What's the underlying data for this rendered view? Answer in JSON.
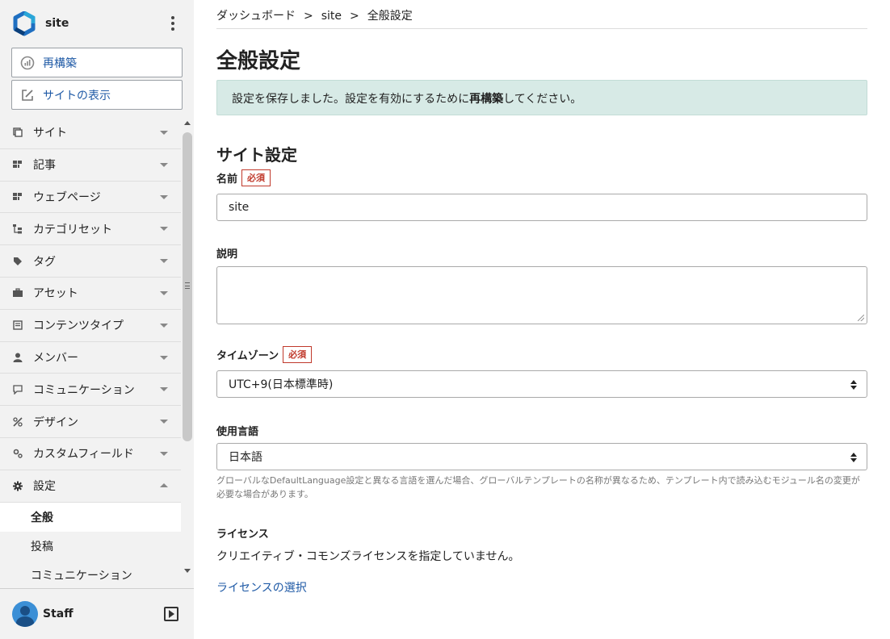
{
  "sidebar": {
    "site_name": "site",
    "rebuild_label": "再構築",
    "view_site_label": "サイトの表示",
    "items": [
      {
        "label": "サイト",
        "icon": "site-icon"
      },
      {
        "label": "記事",
        "icon": "entry-icon"
      },
      {
        "label": "ウェブページ",
        "icon": "page-icon"
      },
      {
        "label": "カテゴリセット",
        "icon": "category-set-icon"
      },
      {
        "label": "タグ",
        "icon": "tag-icon"
      },
      {
        "label": "アセット",
        "icon": "asset-icon"
      },
      {
        "label": "コンテンツタイプ",
        "icon": "content-type-icon"
      },
      {
        "label": "メンバー",
        "icon": "member-icon"
      },
      {
        "label": "コミュニケーション",
        "icon": "communication-icon"
      },
      {
        "label": "デザイン",
        "icon": "design-icon"
      },
      {
        "label": "カスタムフィールド",
        "icon": "custom-field-icon"
      },
      {
        "label": "設定",
        "icon": "gear-icon"
      }
    ],
    "sub_items": [
      {
        "label": "全般"
      },
      {
        "label": "投稿"
      },
      {
        "label": "コミュニケーション"
      }
    ],
    "user_name": "Staff"
  },
  "breadcrumb": [
    "ダッシュボード",
    "site",
    "全般設定"
  ],
  "breadcrumb_sep": ">",
  "page_title": "全般設定",
  "alert": {
    "before": "設定を保存しました。設定を有効にするために",
    "bold": "再構築",
    "after": "してください。"
  },
  "section_title": "サイト設定",
  "required_badge": "必須",
  "fields": {
    "name_label": "名前",
    "name_value": "site",
    "description_label": "説明",
    "description_value": "",
    "timezone_label": "タイムゾーン",
    "timezone_value": "UTC+9(日本標準時)",
    "language_label": "使用言語",
    "language_value": "日本語",
    "language_help": "グローバルなDefaultLanguage設定と異なる言語を選んだ場合、グローバルテンプレートの名称が異なるため、テンプレート内で読み込むモジュール名の変更が必要な場合があります。",
    "license_label": "ライセンス",
    "license_text": "クリエイティブ・コモンズライセンスを指定していません。",
    "license_link": "ライセンスの選択"
  },
  "colors": {
    "accent": "#1f5aa6",
    "alert_bg": "#d7eae6",
    "required": "#c0392b",
    "sidebar_bg": "#f2f2f2"
  }
}
